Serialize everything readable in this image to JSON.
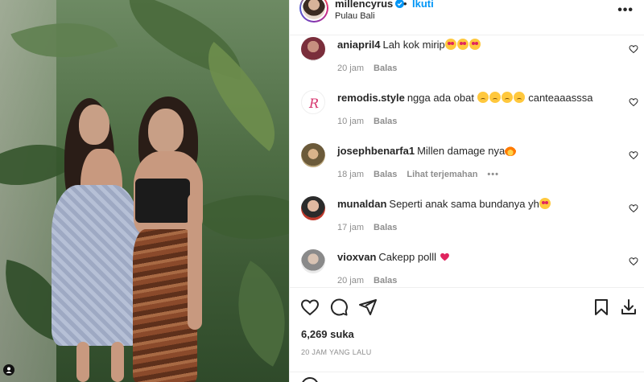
{
  "post": {
    "username": "millencyrus",
    "follow_label": "Ikuti",
    "dot": "•",
    "location": "Pulau Bali",
    "more": "•••"
  },
  "comments": [
    {
      "user": "aniapril4",
      "text": "Lah kok mirip",
      "emojis": [
        "heart-eyes",
        "heart-eyes",
        "heart-eyes"
      ],
      "time": "20 jam",
      "reply": "Balas"
    },
    {
      "user": "remodis.style",
      "text": "ngga ada obat",
      "emojis_mid": [
        "sad",
        "sad",
        "sad",
        "sad"
      ],
      "text_after": "canteaaasssa",
      "time": "10 jam",
      "reply": "Balas"
    },
    {
      "user": "josephbenarfa1",
      "text": "Millen damage nya",
      "emojis": [
        "fire"
      ],
      "time": "18 jam",
      "reply": "Balas",
      "translate": "Lihat terjemahan",
      "more": "•••"
    },
    {
      "user": "munaldan",
      "text": "Seperti anak sama bundanya yh",
      "emojis": [
        "heart-eyes"
      ],
      "time": "17 jam",
      "reply": "Balas"
    },
    {
      "user": "vioxvan",
      "text": "Cakepp polll",
      "emojis": [
        "red-heart"
      ],
      "time": "20 jam",
      "reply": "Balas"
    }
  ],
  "stats": {
    "likes": "6,269 suka",
    "posted": "20 JAM YANG LALU"
  },
  "colors": {
    "accent": "#0095f6",
    "text": "#262626",
    "muted": "#8e8e8e",
    "border": "#efefef"
  },
  "icons": [
    "verified-icon",
    "more-icon",
    "heart-icon",
    "comment-icon",
    "share-icon",
    "bookmark-icon",
    "download-icon",
    "emoji-icon"
  ]
}
